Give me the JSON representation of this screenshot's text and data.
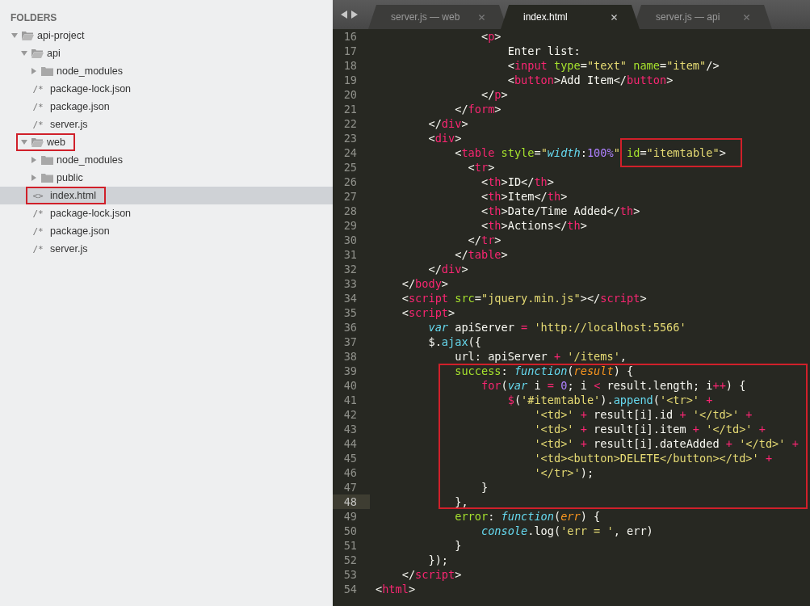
{
  "sidebar": {
    "heading": "FOLDERS",
    "tree": [
      {
        "kind": "folder",
        "name": "api-project",
        "expanded": true,
        "selected": false,
        "highlighted": false,
        "children": [
          {
            "kind": "folder",
            "name": "api",
            "expanded": true,
            "selected": false,
            "highlighted": false,
            "children": [
              {
                "kind": "folder",
                "name": "node_modules",
                "expanded": false,
                "selected": false,
                "highlighted": false
              },
              {
                "kind": "file",
                "glyph": "/*",
                "name": "package-lock.json",
                "selected": false,
                "highlighted": false
              },
              {
                "kind": "file",
                "glyph": "/*",
                "name": "package.json",
                "selected": false,
                "highlighted": false
              },
              {
                "kind": "file",
                "glyph": "/*",
                "name": "server.js",
                "selected": false,
                "highlighted": false
              }
            ]
          },
          {
            "kind": "folder",
            "name": "web",
            "expanded": true,
            "selected": false,
            "highlighted": true,
            "children": [
              {
                "kind": "folder",
                "name": "node_modules",
                "expanded": false,
                "selected": false,
                "highlighted": false
              },
              {
                "kind": "folder",
                "name": "public",
                "expanded": false,
                "selected": false,
                "highlighted": false
              },
              {
                "kind": "file",
                "glyph": "<>",
                "name": "index.html",
                "selected": true,
                "highlighted": true
              },
              {
                "kind": "file",
                "glyph": "/*",
                "name": "package-lock.json",
                "selected": false,
                "highlighted": false
              },
              {
                "kind": "file",
                "glyph": "/*",
                "name": "package.json",
                "selected": false,
                "highlighted": false
              },
              {
                "kind": "file",
                "glyph": "/*",
                "name": "server.js",
                "selected": false,
                "highlighted": false
              }
            ]
          }
        ]
      }
    ]
  },
  "tabs": [
    {
      "label": "server.js — web",
      "selected": false
    },
    {
      "label": "index.html",
      "selected": true
    },
    {
      "label": "server.js — api",
      "selected": false
    }
  ],
  "code": {
    "lines": [
      {
        "kind": "line",
        "number": "16",
        "current": false,
        "tokens": [
          {
            "kind": "plain",
            "text": "                <"
          },
          {
            "kind": "tag",
            "text": "p"
          },
          {
            "kind": "plain",
            "text": ">"
          }
        ]
      },
      {
        "kind": "line",
        "number": "17",
        "current": false,
        "tokens": [
          {
            "kind": "plain",
            "text": "                    Enter list:"
          }
        ]
      },
      {
        "kind": "line",
        "number": "18",
        "current": false,
        "tokens": [
          {
            "kind": "plain",
            "text": "                    <"
          },
          {
            "kind": "tag",
            "text": "input"
          },
          {
            "kind": "attr",
            "text": " type"
          },
          {
            "kind": "plain",
            "text": "="
          },
          {
            "kind": "string",
            "text": "\"text\""
          },
          {
            "kind": "attr",
            "text": " name"
          },
          {
            "kind": "plain",
            "text": "="
          },
          {
            "kind": "string",
            "text": "\"item\""
          },
          {
            "kind": "plain",
            "text": "/>"
          }
        ]
      },
      {
        "kind": "line",
        "number": "19",
        "current": false,
        "tokens": [
          {
            "kind": "plain",
            "text": "                    <"
          },
          {
            "kind": "tag",
            "text": "button"
          },
          {
            "kind": "plain",
            "text": ">Add Item</"
          },
          {
            "kind": "tag",
            "text": "button"
          },
          {
            "kind": "plain",
            "text": ">"
          }
        ]
      },
      {
        "kind": "line",
        "number": "20",
        "current": false,
        "tokens": [
          {
            "kind": "plain",
            "text": "                </"
          },
          {
            "kind": "tag",
            "text": "p"
          },
          {
            "kind": "plain",
            "text": ">"
          }
        ]
      },
      {
        "kind": "line",
        "number": "21",
        "current": false,
        "tokens": [
          {
            "kind": "plain",
            "text": "            </"
          },
          {
            "kind": "tag",
            "text": "form"
          },
          {
            "kind": "plain",
            "text": ">"
          }
        ]
      },
      {
        "kind": "line",
        "number": "22",
        "current": false,
        "tokens": [
          {
            "kind": "plain",
            "text": "        </"
          },
          {
            "kind": "tag",
            "text": "div"
          },
          {
            "kind": "plain",
            "text": ">"
          }
        ]
      },
      {
        "kind": "line",
        "number": "23",
        "current": false,
        "tokens": [
          {
            "kind": "plain",
            "text": "        <"
          },
          {
            "kind": "tag",
            "text": "div"
          },
          {
            "kind": "plain",
            "text": ">"
          }
        ]
      },
      {
        "kind": "line",
        "number": "24",
        "current": false,
        "tokens": [
          {
            "kind": "plain",
            "text": "            <"
          },
          {
            "kind": "tag",
            "text": "table"
          },
          {
            "kind": "attr",
            "text": " style"
          },
          {
            "kind": "plain",
            "text": "="
          },
          {
            "kind": "string",
            "text": "\""
          },
          {
            "kind": "keyword",
            "text": "width"
          },
          {
            "kind": "plain",
            "text": ":"
          },
          {
            "kind": "number",
            "text": "100%"
          },
          {
            "kind": "string",
            "text": "\" "
          },
          {
            "kind": "boxed",
            "tokens": [
              {
                "kind": "attr",
                "text": "id"
              },
              {
                "kind": "plain",
                "text": "="
              },
              {
                "kind": "string",
                "text": "\"itemtable\""
              },
              {
                "kind": "plain",
                "text": ">"
              }
            ]
          }
        ]
      },
      {
        "kind": "line",
        "number": "25",
        "current": false,
        "tokens": [
          {
            "kind": "plain",
            "text": "              <"
          },
          {
            "kind": "tag",
            "text": "tr"
          },
          {
            "kind": "plain",
            "text": ">"
          }
        ]
      },
      {
        "kind": "line",
        "number": "26",
        "current": false,
        "tokens": [
          {
            "kind": "plain",
            "text": "                <"
          },
          {
            "kind": "tag",
            "text": "th"
          },
          {
            "kind": "plain",
            "text": ">ID</"
          },
          {
            "kind": "tag",
            "text": "th"
          },
          {
            "kind": "plain",
            "text": ">"
          }
        ]
      },
      {
        "kind": "line",
        "number": "27",
        "current": false,
        "tokens": [
          {
            "kind": "plain",
            "text": "                <"
          },
          {
            "kind": "tag",
            "text": "th"
          },
          {
            "kind": "plain",
            "text": ">Item</"
          },
          {
            "kind": "tag",
            "text": "th"
          },
          {
            "kind": "plain",
            "text": ">"
          }
        ]
      },
      {
        "kind": "line",
        "number": "28",
        "current": false,
        "tokens": [
          {
            "kind": "plain",
            "text": "                <"
          },
          {
            "kind": "tag",
            "text": "th"
          },
          {
            "kind": "plain",
            "text": ">Date/Time Added</"
          },
          {
            "kind": "tag",
            "text": "th"
          },
          {
            "kind": "plain",
            "text": ">"
          }
        ]
      },
      {
        "kind": "line",
        "number": "29",
        "current": false,
        "tokens": [
          {
            "kind": "plain",
            "text": "                <"
          },
          {
            "kind": "tag",
            "text": "th"
          },
          {
            "kind": "plain",
            "text": ">Actions</"
          },
          {
            "kind": "tag",
            "text": "th"
          },
          {
            "kind": "plain",
            "text": ">"
          }
        ]
      },
      {
        "kind": "line",
        "number": "30",
        "current": false,
        "tokens": [
          {
            "kind": "plain",
            "text": "              </"
          },
          {
            "kind": "tag",
            "text": "tr"
          },
          {
            "kind": "plain",
            "text": ">"
          }
        ]
      },
      {
        "kind": "line",
        "number": "31",
        "current": false,
        "tokens": [
          {
            "kind": "plain",
            "text": "            </"
          },
          {
            "kind": "tag",
            "text": "table"
          },
          {
            "kind": "plain",
            "text": ">"
          }
        ]
      },
      {
        "kind": "line",
        "number": "32",
        "current": false,
        "tokens": [
          {
            "kind": "plain",
            "text": "        </"
          },
          {
            "kind": "tag",
            "text": "div"
          },
          {
            "kind": "plain",
            "text": ">"
          }
        ]
      },
      {
        "kind": "line",
        "number": "33",
        "current": false,
        "tokens": [
          {
            "kind": "plain",
            "text": "    </"
          },
          {
            "kind": "tag",
            "text": "body"
          },
          {
            "kind": "plain",
            "text": ">"
          }
        ]
      },
      {
        "kind": "line",
        "number": "34",
        "current": false,
        "tokens": [
          {
            "kind": "plain",
            "text": "    <"
          },
          {
            "kind": "tag",
            "text": "script"
          },
          {
            "kind": "attr",
            "text": " src"
          },
          {
            "kind": "plain",
            "text": "="
          },
          {
            "kind": "string",
            "text": "\"jquery.min.js\""
          },
          {
            "kind": "plain",
            "text": "></"
          },
          {
            "kind": "tag",
            "text": "script"
          },
          {
            "kind": "plain",
            "text": ">"
          }
        ]
      },
      {
        "kind": "line",
        "number": "35",
        "current": false,
        "tokens": [
          {
            "kind": "plain",
            "text": "    <"
          },
          {
            "kind": "tag",
            "text": "script"
          },
          {
            "kind": "plain",
            "text": ">"
          }
        ]
      },
      {
        "kind": "line",
        "number": "36",
        "current": false,
        "tokens": [
          {
            "kind": "keyword",
            "text": "        var"
          },
          {
            "kind": "plain",
            "text": " apiServer "
          },
          {
            "kind": "op",
            "text": "="
          },
          {
            "kind": "string",
            "text": " 'http://localhost:5566'"
          }
        ]
      },
      {
        "kind": "line",
        "number": "37",
        "current": false,
        "tokens": [
          {
            "kind": "plain",
            "text": "        $."
          },
          {
            "kind": "func",
            "text": "ajax"
          },
          {
            "kind": "plain",
            "text": "({"
          }
        ]
      },
      {
        "kind": "line",
        "number": "38",
        "current": false,
        "tokens": [
          {
            "kind": "plain",
            "text": "            url: apiServer "
          },
          {
            "kind": "op",
            "text": "+"
          },
          {
            "kind": "string",
            "text": " '/items'"
          },
          {
            "kind": "plain",
            "text": ","
          }
        ]
      },
      {
        "kind": "boxed",
        "lines": [
          {
            "kind": "line",
            "number": "39",
            "current": false,
            "tokens": [
              {
                "kind": "attr",
                "text": "            success"
              },
              {
                "kind": "plain",
                "text": ": "
              },
              {
                "kind": "keyword",
                "text": "function"
              },
              {
                "kind": "plain",
                "text": "("
              },
              {
                "kind": "param",
                "text": "result"
              },
              {
                "kind": "plain",
                "text": ") {"
              }
            ]
          },
          {
            "kind": "line",
            "number": "40",
            "current": false,
            "tokens": [
              {
                "kind": "op",
                "text": "                for"
              },
              {
                "kind": "plain",
                "text": "("
              },
              {
                "kind": "keyword",
                "text": "var"
              },
              {
                "kind": "plain",
                "text": " i "
              },
              {
                "kind": "op",
                "text": "="
              },
              {
                "kind": "number",
                "text": " 0"
              },
              {
                "kind": "plain",
                "text": "; i "
              },
              {
                "kind": "op",
                "text": "<"
              },
              {
                "kind": "plain",
                "text": " result.length; i"
              },
              {
                "kind": "op",
                "text": "++"
              },
              {
                "kind": "plain",
                "text": ") {"
              }
            ]
          },
          {
            "kind": "line",
            "number": "41",
            "current": false,
            "tokens": [
              {
                "kind": "op",
                "text": "                    $"
              },
              {
                "kind": "plain",
                "text": "("
              },
              {
                "kind": "string",
                "text": "'#itemtable'"
              },
              {
                "kind": "plain",
                "text": ")."
              },
              {
                "kind": "func",
                "text": "append"
              },
              {
                "kind": "plain",
                "text": "("
              },
              {
                "kind": "string",
                "text": "'<tr>' "
              },
              {
                "kind": "op",
                "text": "+"
              }
            ]
          },
          {
            "kind": "line",
            "number": "42",
            "current": false,
            "tokens": [
              {
                "kind": "string",
                "text": "                        '<td>' "
              },
              {
                "kind": "op",
                "text": "+"
              },
              {
                "kind": "plain",
                "text": " result[i].id "
              },
              {
                "kind": "op",
                "text": "+"
              },
              {
                "kind": "string",
                "text": " '</td>' "
              },
              {
                "kind": "op",
                "text": "+"
              }
            ]
          },
          {
            "kind": "line",
            "number": "43",
            "current": false,
            "tokens": [
              {
                "kind": "string",
                "text": "                        '<td>' "
              },
              {
                "kind": "op",
                "text": "+"
              },
              {
                "kind": "plain",
                "text": " result[i].item "
              },
              {
                "kind": "op",
                "text": "+"
              },
              {
                "kind": "string",
                "text": " '</td>' "
              },
              {
                "kind": "op",
                "text": "+"
              }
            ]
          },
          {
            "kind": "line",
            "number": "44",
            "current": false,
            "tokens": [
              {
                "kind": "string",
                "text": "                        '<td>' "
              },
              {
                "kind": "op",
                "text": "+"
              },
              {
                "kind": "plain",
                "text": " result[i].dateAdded "
              },
              {
                "kind": "op",
                "text": "+"
              },
              {
                "kind": "string",
                "text": " '</td>' "
              },
              {
                "kind": "op",
                "text": "+"
              }
            ]
          },
          {
            "kind": "line",
            "number": "45",
            "current": false,
            "tokens": [
              {
                "kind": "string",
                "text": "                        '<td><button>DELETE</button></td>' "
              },
              {
                "kind": "op",
                "text": "+"
              }
            ]
          },
          {
            "kind": "line",
            "number": "46",
            "current": false,
            "tokens": [
              {
                "kind": "string",
                "text": "                        '</tr>'"
              },
              {
                "kind": "plain",
                "text": ");"
              }
            ]
          },
          {
            "kind": "line",
            "number": "47",
            "current": false,
            "tokens": [
              {
                "kind": "plain",
                "text": "                }"
              }
            ]
          },
          {
            "kind": "line",
            "number": "48",
            "current": true,
            "tokens": [
              {
                "kind": "plain",
                "text": "            },"
              }
            ]
          }
        ]
      },
      {
        "kind": "line",
        "number": "49",
        "current": false,
        "tokens": [
          {
            "kind": "attr",
            "text": "            error"
          },
          {
            "kind": "plain",
            "text": ": "
          },
          {
            "kind": "keyword",
            "text": "function"
          },
          {
            "kind": "plain",
            "text": "("
          },
          {
            "kind": "param",
            "text": "err"
          },
          {
            "kind": "plain",
            "text": ") {"
          }
        ]
      },
      {
        "kind": "line",
        "number": "50",
        "current": false,
        "tokens": [
          {
            "kind": "keyword",
            "text": "                console"
          },
          {
            "kind": "plain",
            "text": ".log("
          },
          {
            "kind": "string",
            "text": "'err = '"
          },
          {
            "kind": "plain",
            "text": ", err)"
          }
        ]
      },
      {
        "kind": "line",
        "number": "51",
        "current": false,
        "tokens": [
          {
            "kind": "plain",
            "text": "            }"
          }
        ]
      },
      {
        "kind": "line",
        "number": "52",
        "current": false,
        "tokens": [
          {
            "kind": "plain",
            "text": "        });"
          }
        ]
      },
      {
        "kind": "line",
        "number": "53",
        "current": false,
        "tokens": [
          {
            "kind": "plain",
            "text": "    </"
          },
          {
            "kind": "tag",
            "text": "script"
          },
          {
            "kind": "plain",
            "text": ">"
          }
        ]
      },
      {
        "kind": "line",
        "number": "54",
        "current": false,
        "tokens": [
          {
            "kind": "plain",
            "text": "<"
          },
          {
            "kind": "tag",
            "text": "html"
          },
          {
            "kind": "plain",
            "text": ">"
          }
        ]
      }
    ]
  }
}
